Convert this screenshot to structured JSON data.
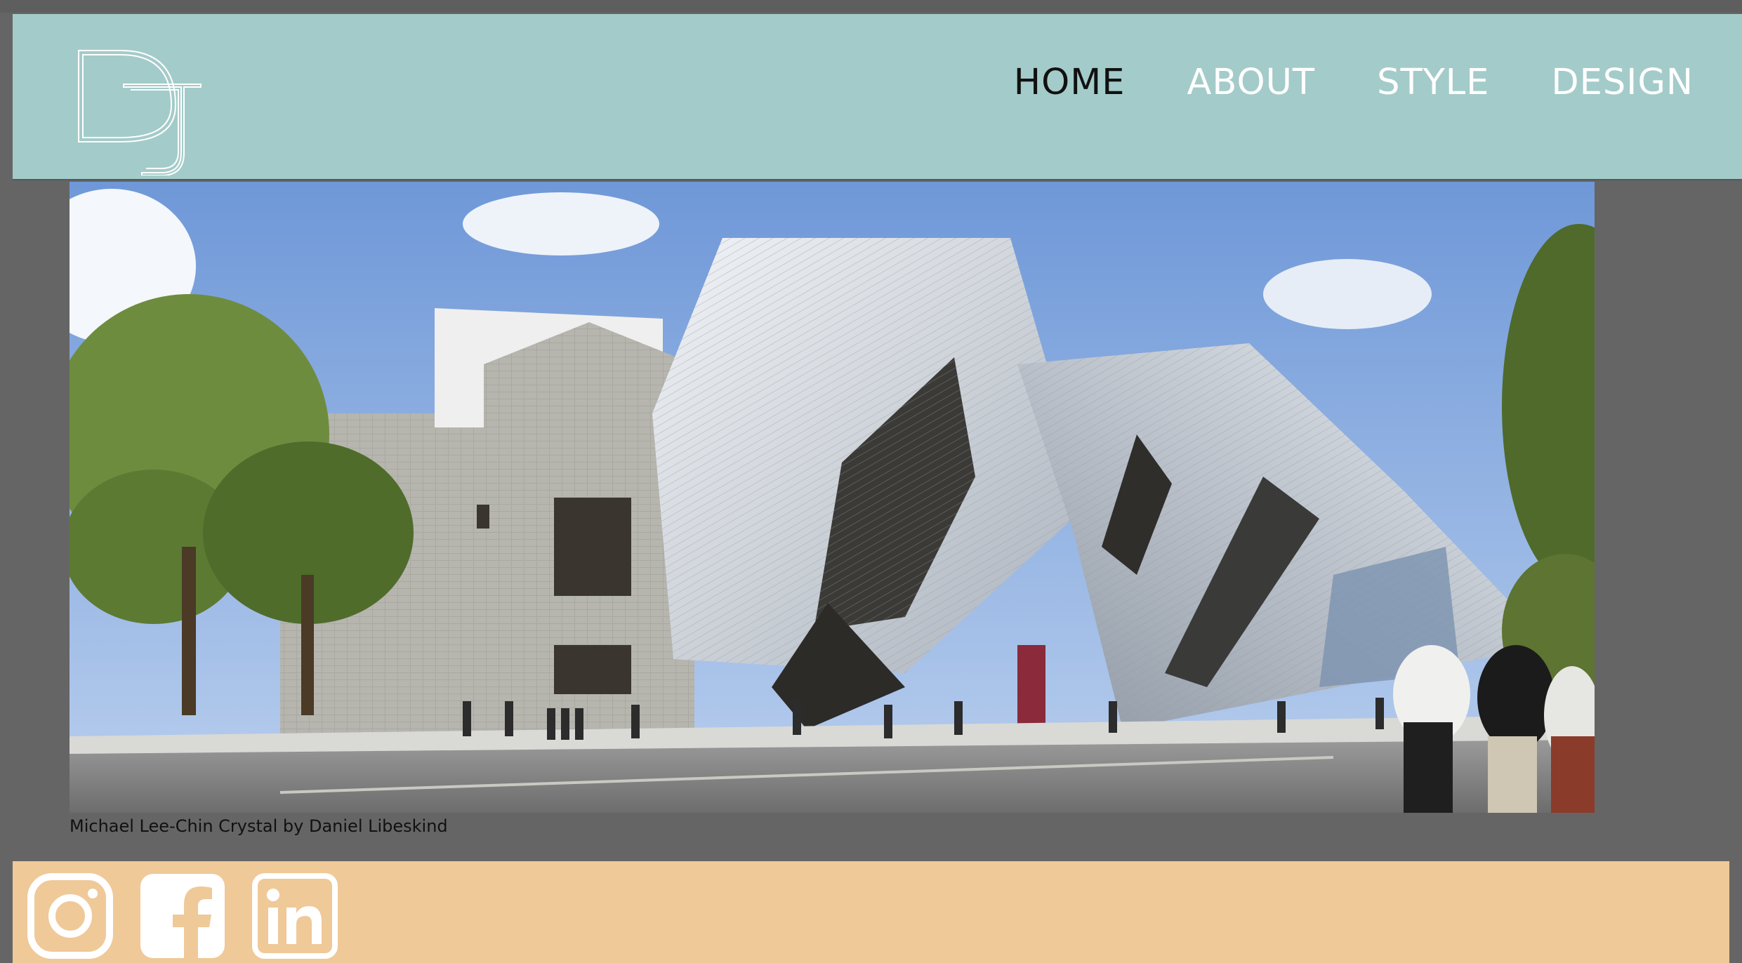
{
  "site": {
    "logo_icon": "dj-monogram-icon"
  },
  "nav": {
    "items": [
      {
        "label": "HOME",
        "active": true
      },
      {
        "label": "ABOUT",
        "active": false
      },
      {
        "label": "STYLE",
        "active": false
      },
      {
        "label": "DESIGN",
        "active": false
      }
    ]
  },
  "hero": {
    "image_icon": "building-photo",
    "caption": "Michael Lee-Chin Crystal by Daniel Libeskind"
  },
  "footer": {
    "social": [
      {
        "icon": "instagram-icon"
      },
      {
        "icon": "facebook-icon"
      },
      {
        "icon": "linkedin-icon"
      }
    ]
  },
  "colors": {
    "header_bg": "#a3cbc9",
    "page_bg": "#656565",
    "footer_bg": "#efc998",
    "nav_active": "#111111",
    "nav_inactive": "#ffffff"
  }
}
